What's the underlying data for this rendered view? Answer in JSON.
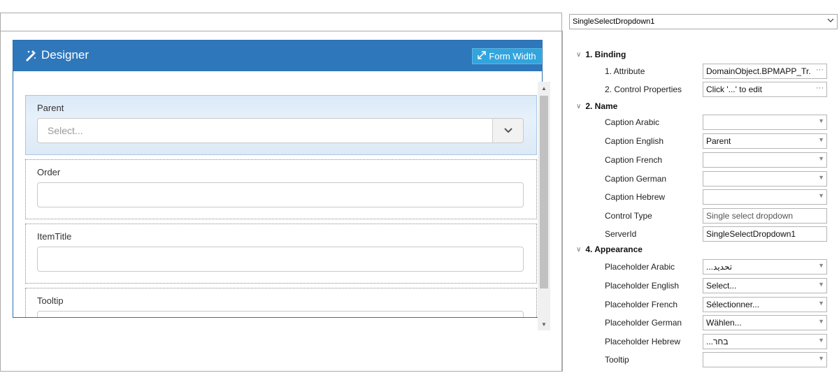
{
  "designer": {
    "title": "Designer",
    "form_width_label": "Form Width",
    "fields": [
      {
        "label": "Parent",
        "placeholder": "Select..."
      },
      {
        "label": "Order"
      },
      {
        "label": "ItemTitle"
      },
      {
        "label": "Tooltip"
      }
    ]
  },
  "properties": {
    "object_name": "SingleSelectDropdown1",
    "sections": [
      {
        "title": "1. Binding"
      },
      {
        "title": "2. Name"
      },
      {
        "title": "4. Appearance"
      }
    ],
    "rows": [
      {
        "name": "1. Attribute",
        "value": "DomainObject.BPMAPP_Tr..."
      },
      {
        "name": "2. Control Properties",
        "value": "Click '...' to edit"
      },
      {
        "name": "Caption Arabic",
        "value": ""
      },
      {
        "name": "Caption English",
        "value": "Parent"
      },
      {
        "name": "Caption French",
        "value": ""
      },
      {
        "name": "Caption German",
        "value": ""
      },
      {
        "name": "Caption Hebrew",
        "value": ""
      },
      {
        "name": "Control Type",
        "value": "Single select dropdown"
      },
      {
        "name": "ServerId",
        "value": "SingleSelectDropdown1"
      },
      {
        "name": "Placeholder Arabic",
        "value": "...تحديد"
      },
      {
        "name": "Placeholder English",
        "value": "Select..."
      },
      {
        "name": "Placeholder French",
        "value": "Sélectionner..."
      },
      {
        "name": "Placeholder German",
        "value": "Wählen..."
      },
      {
        "name": "Placeholder Hebrew",
        "value": "...בחר"
      },
      {
        "name": "Tooltip",
        "value": ""
      }
    ]
  },
  "colors": {
    "header_blue": "#2e77bb",
    "button_blue": "#33a4dc",
    "selected_field_bg": "#dbe9f7"
  },
  "icons": {
    "designer": "wand-pencil-icon",
    "form_width": "resize-icon",
    "dropdown": "chevron-down-icon",
    "ellipsis": "ellipsis-icon"
  }
}
